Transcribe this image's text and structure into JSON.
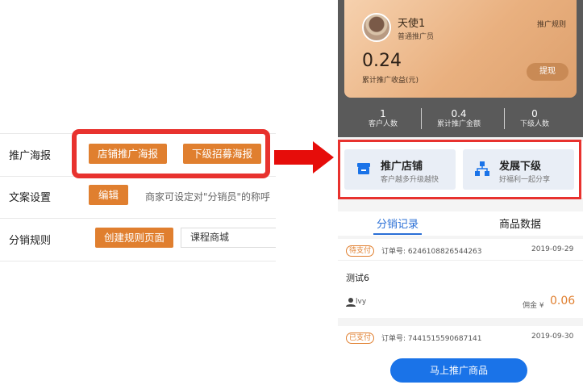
{
  "settings": {
    "rows": [
      {
        "label": "推广海报",
        "buttons": [
          "店铺推广海报",
          "下级招募海报"
        ]
      },
      {
        "label": "文案设置",
        "button": "编辑",
        "hint": "商家可设定对\"分销员\"的称呼"
      },
      {
        "label": "分销规则",
        "button": "创建规则页面",
        "input_value": "课程商城"
      }
    ]
  },
  "profile": {
    "name": "天使1",
    "role": "普通推广员",
    "rules_link": "推广规则",
    "earnings": "0.24",
    "earnings_label": "累计推广收益(元)",
    "withdraw": "提现"
  },
  "stats": [
    {
      "value": "1",
      "label": "客户人数"
    },
    {
      "value": "0.4",
      "label": "累计推广金额"
    },
    {
      "value": "0",
      "label": "下级人数"
    }
  ],
  "features": [
    {
      "title": "推广店铺",
      "subtitle": "客户越多升级越快",
      "icon": "store-icon"
    },
    {
      "title": "发展下级",
      "subtitle": "好福利一起分享",
      "icon": "org-chart-icon"
    }
  ],
  "tabs": [
    "分销记录",
    "商品数据"
  ],
  "orders": [
    {
      "status": "待支付",
      "order_no": "订单号: 6246108826544263",
      "date": "2019-09-29",
      "product": "测试6",
      "user": "lvy",
      "commission_label": "佣金 ¥",
      "commission": "0.06"
    },
    {
      "status": "已支付",
      "order_no": "订单号: 7441515590687141",
      "date": "2019-09-30"
    }
  ],
  "promote_button": "马上推广商品",
  "colors": {
    "accent_orange": "#e07f2f",
    "highlight_red": "#e8322e",
    "primary_blue": "#1a73e8"
  }
}
